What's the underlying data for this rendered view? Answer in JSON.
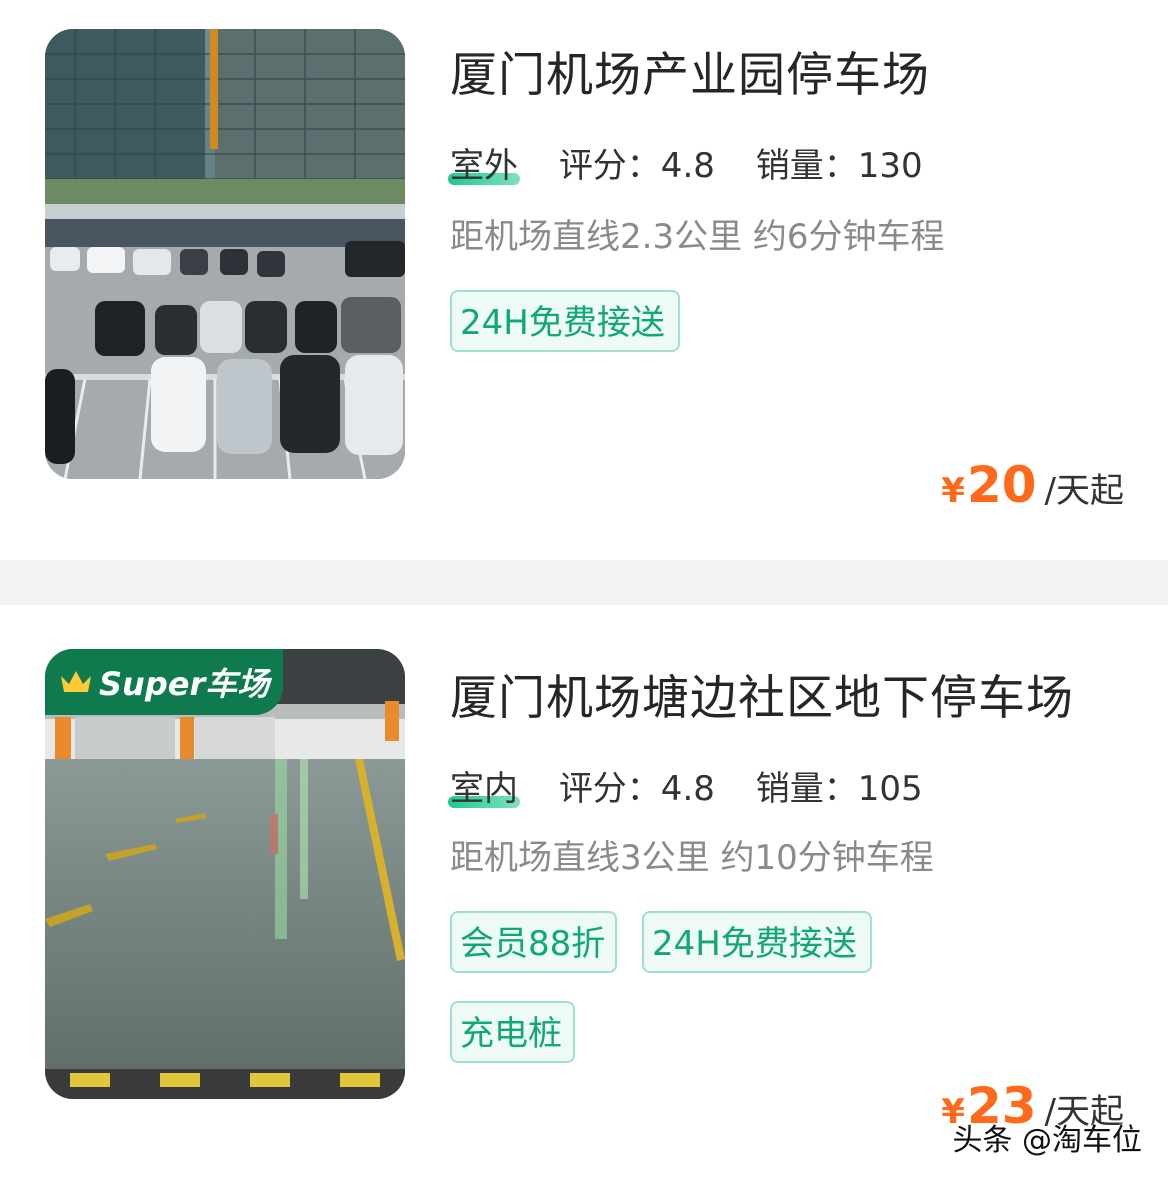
{
  "listings": [
    {
      "title": "厦门机场产业园停车场",
      "type": "室外",
      "rating_label": "评分：4.8",
      "sales_label": "销量：130",
      "distance": "距机场直线2.3公里 约6分钟车程",
      "tags": [
        "24H免费接送"
      ],
      "price_symbol": "¥",
      "price": "20",
      "price_unit": "/天起",
      "photo_icon": "outdoor-parking-lot-photo"
    },
    {
      "title": "厦门机场塘边社区地下停车场",
      "type": "室内",
      "rating_label": "评分：4.8",
      "sales_label": "销量：105",
      "distance": "距机场直线3公里 约10分钟车程",
      "tags": [
        "会员88折",
        "24H免费接送",
        "充电桩"
      ],
      "price_symbol": "¥",
      "price": "23",
      "price_unit": "/天起",
      "badge": "Super车场",
      "photo_icon": "underground-garage-photo"
    }
  ],
  "watermark": "头条 @淘车位",
  "colors": {
    "accent": "#ff6a1a",
    "tag_text": "#11a876",
    "tag_border": "#9fe0c8",
    "badge_bg": "#0f7a4d"
  }
}
